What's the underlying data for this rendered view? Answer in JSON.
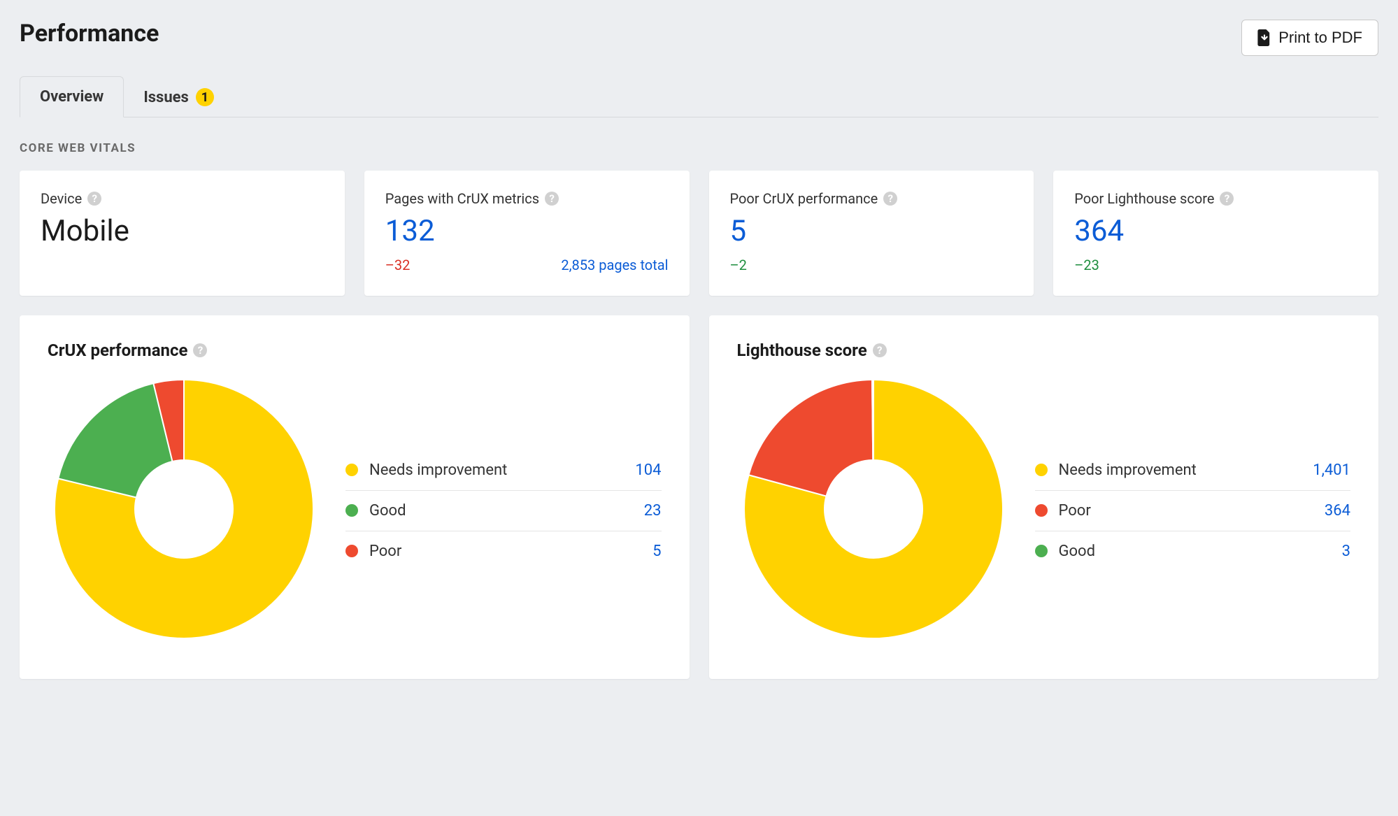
{
  "header": {
    "title": "Performance",
    "print_button": "Print to PDF"
  },
  "tabs": {
    "overview": "Overview",
    "issues": "Issues",
    "issues_badge": "1"
  },
  "section_label": "CORE WEB VITALS",
  "metrics": {
    "device": {
      "title": "Device",
      "value": "Mobile"
    },
    "pages_crux": {
      "title": "Pages with CrUX metrics",
      "value": "132",
      "delta": "–32",
      "delta_sentiment": "neg",
      "secondary": "2,853 pages total"
    },
    "poor_crux": {
      "title": "Poor CrUX performance",
      "value": "5",
      "delta": "–2",
      "delta_sentiment": "pos"
    },
    "poor_lighthouse": {
      "title": "Poor Lighthouse score",
      "value": "364",
      "delta": "–23",
      "delta_sentiment": "pos"
    }
  },
  "colors": {
    "yellow": "#ffd200",
    "green": "#4caf50",
    "red": "#ee4a2f"
  },
  "chart_data": [
    {
      "type": "pie",
      "title": "CrUX performance",
      "series": [
        {
          "name": "Needs improvement",
          "value": 104,
          "display": "104",
          "color": "yellow"
        },
        {
          "name": "Good",
          "value": 23,
          "display": "23",
          "color": "green"
        },
        {
          "name": "Poor",
          "value": 5,
          "display": "5",
          "color": "red"
        }
      ]
    },
    {
      "type": "pie",
      "title": "Lighthouse score",
      "series": [
        {
          "name": "Needs improvement",
          "value": 1401,
          "display": "1,401",
          "color": "yellow"
        },
        {
          "name": "Poor",
          "value": 364,
          "display": "364",
          "color": "red"
        },
        {
          "name": "Good",
          "value": 3,
          "display": "3",
          "color": "green"
        }
      ]
    }
  ]
}
